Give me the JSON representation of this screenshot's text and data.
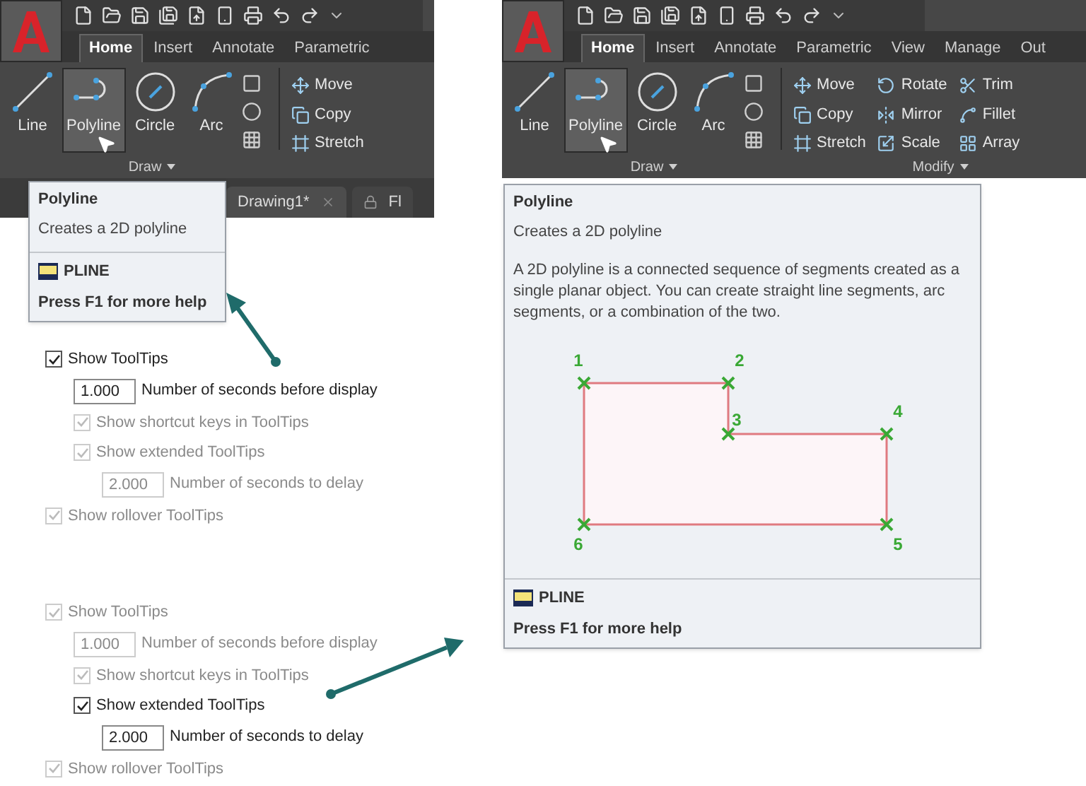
{
  "left_screenshot": {
    "ribbon": {
      "tabs": [
        {
          "label": "Home",
          "selected": true
        },
        {
          "label": "Insert",
          "selected": false
        },
        {
          "label": "Annotate",
          "selected": false
        },
        {
          "label": "Parametric",
          "selected": false
        }
      ],
      "draw_tools": [
        {
          "label": "Line",
          "highlighted": false
        },
        {
          "label": "Polyline",
          "highlighted": true
        },
        {
          "label": "Circle",
          "highlighted": false
        },
        {
          "label": "Arc",
          "highlighted": false
        }
      ],
      "modify_tools": [
        [
          "Move",
          "Copy",
          "Stretch"
        ]
      ],
      "panel_labels": [
        "Draw"
      ]
    },
    "document_tabs": [
      {
        "label": "Drawing1*",
        "locked": false
      },
      {
        "label": "Fl",
        "locked": true
      }
    ],
    "tooltip": {
      "title": "Polyline",
      "description": "Creates a 2D polyline",
      "command": "PLINE",
      "help": "Press F1 for more help"
    }
  },
  "options_before": {
    "items": [
      {
        "kind": "checkbox",
        "label": "Show ToolTips",
        "checked": true,
        "disabled": false,
        "children": [
          {
            "kind": "number",
            "value": "1.000",
            "label": "Number of seconds before display",
            "disabled": false
          },
          {
            "kind": "checkbox",
            "label": "Show shortcut keys in ToolTips",
            "checked": true,
            "disabled": true
          },
          {
            "kind": "checkbox",
            "label": "Show extended ToolTips",
            "checked": true,
            "disabled": true,
            "children": [
              {
                "kind": "number",
                "value": "2.000",
                "label": "Number of seconds to delay",
                "disabled": true
              }
            ]
          }
        ]
      },
      {
        "kind": "checkbox",
        "label": "Show rollover ToolTips",
        "checked": true,
        "disabled": true
      }
    ]
  },
  "options_after": {
    "items": [
      {
        "kind": "checkbox",
        "label": "Show ToolTips",
        "checked": true,
        "disabled": true,
        "children": [
          {
            "kind": "number",
            "value": "1.000",
            "label": "Number of seconds before display",
            "disabled": true
          },
          {
            "kind": "checkbox",
            "label": "Show shortcut keys in ToolTips",
            "checked": true,
            "disabled": true
          },
          {
            "kind": "checkbox",
            "label": "Show extended ToolTips",
            "checked": true,
            "disabled": false,
            "children": [
              {
                "kind": "number",
                "value": "2.000",
                "label": "Number of seconds to delay",
                "disabled": false
              }
            ]
          }
        ]
      },
      {
        "kind": "checkbox",
        "label": "Show rollover ToolTips",
        "checked": true,
        "disabled": true
      }
    ]
  },
  "right_screenshot": {
    "ribbon": {
      "tabs": [
        {
          "label": "Home",
          "selected": true
        },
        {
          "label": "Insert",
          "selected": false
        },
        {
          "label": "Annotate",
          "selected": false
        },
        {
          "label": "Parametric",
          "selected": false
        },
        {
          "label": "View",
          "selected": false
        },
        {
          "label": "Manage",
          "selected": false
        },
        {
          "label": "Out",
          "selected": false
        }
      ],
      "draw_tools": [
        {
          "label": "Line",
          "highlighted": false
        },
        {
          "label": "Polyline",
          "highlighted": true
        },
        {
          "label": "Circle",
          "highlighted": false
        },
        {
          "label": "Arc",
          "highlighted": false
        }
      ],
      "modify_tools": [
        [
          "Move",
          "Copy",
          "Stretch"
        ],
        [
          "Rotate",
          "Mirror",
          "Scale"
        ],
        [
          "Trim",
          "Fillet",
          "Array"
        ]
      ],
      "panel_labels": [
        "Draw",
        "Modify"
      ]
    },
    "tooltip": {
      "title": "Polyline",
      "description": "Creates a 2D polyline",
      "details": "A 2D polyline is a connected sequence of segments created as a single planar object. You can create straight line segments, arc segments, or a combination of the two.",
      "vertex_labels": [
        "1",
        "2",
        "3",
        "4",
        "5",
        "6"
      ],
      "command": "PLINE",
      "help": "Press F1 for more help"
    }
  }
}
